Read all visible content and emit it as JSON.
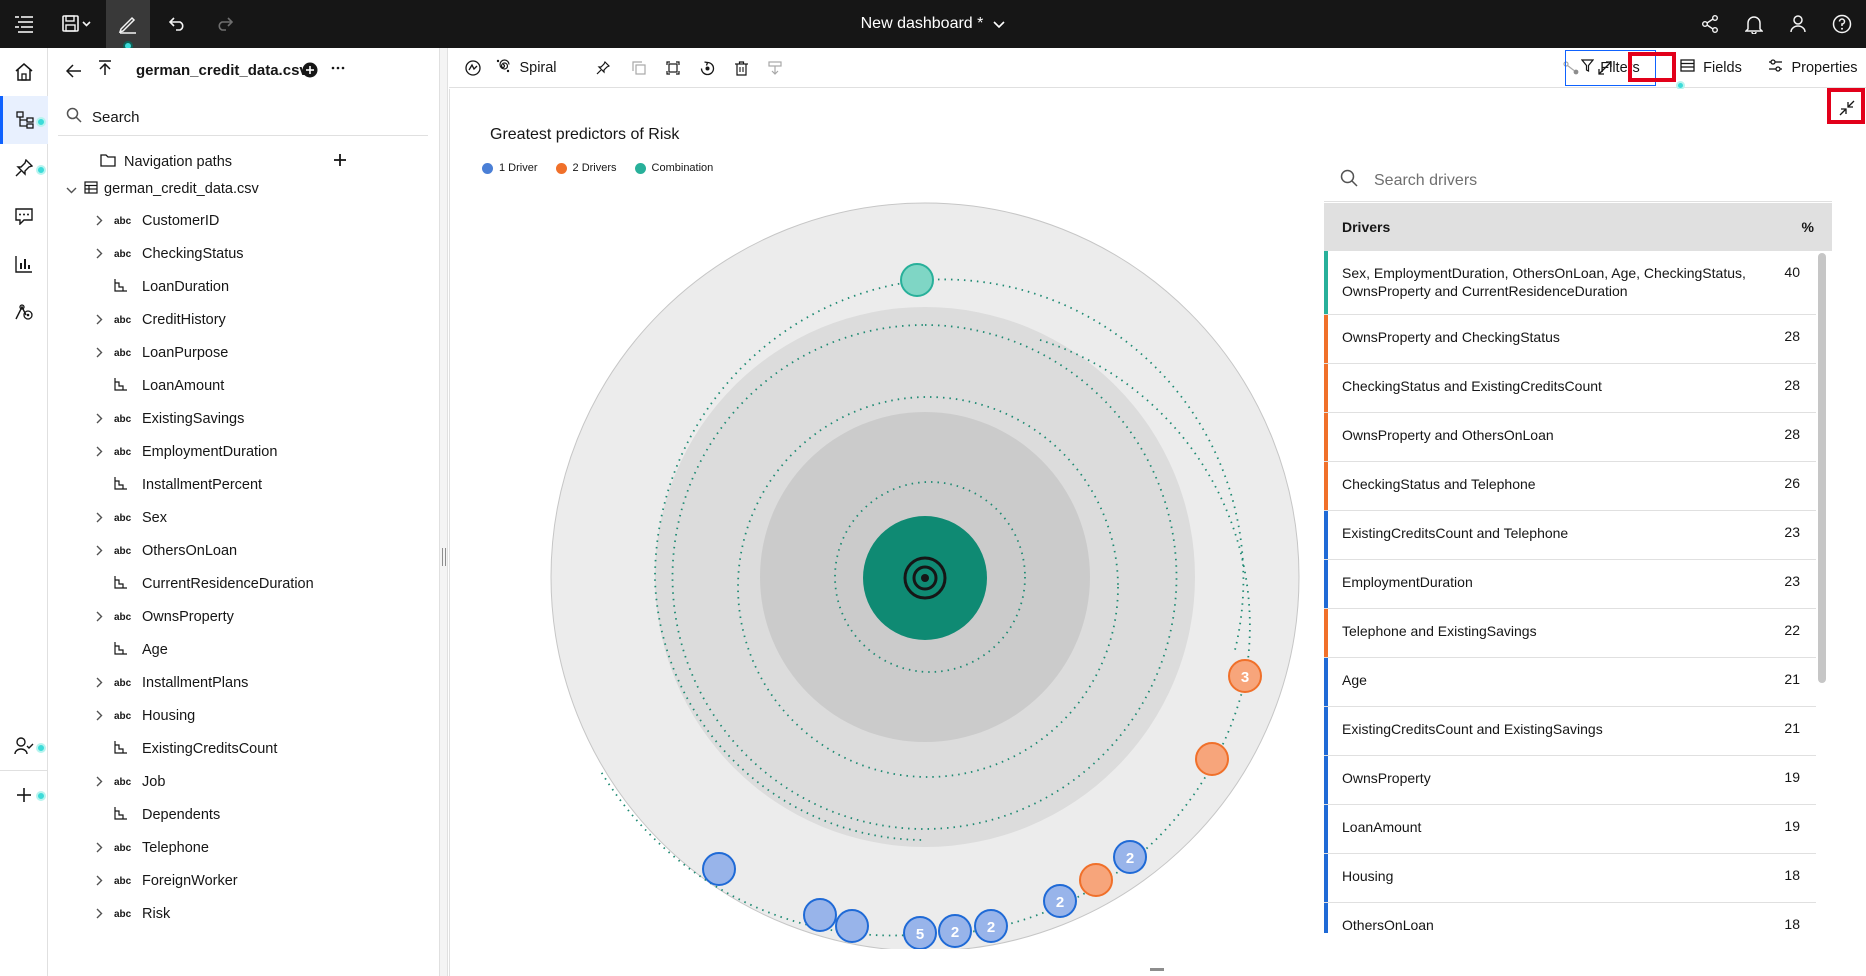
{
  "topbar": {
    "title": "New dashboard *",
    "icons": [
      "menu-icon",
      "save-icon",
      "edit-icon",
      "undo-icon",
      "redo-icon",
      "share-icon",
      "notification-icon",
      "user-icon",
      "help-icon"
    ]
  },
  "data_panel": {
    "file_name": "german_credit_data.csv",
    "search_label": "Search",
    "navigation_paths": "Navigation paths",
    "source_name": "german_credit_data.csv",
    "columns": [
      {
        "name": "CustomerID",
        "type": "abc",
        "expandable": true
      },
      {
        "name": "CheckingStatus",
        "type": "abc",
        "expandable": true
      },
      {
        "name": "LoanDuration",
        "type": "measure",
        "expandable": false
      },
      {
        "name": "CreditHistory",
        "type": "abc",
        "expandable": true
      },
      {
        "name": "LoanPurpose",
        "type": "abc",
        "expandable": true
      },
      {
        "name": "LoanAmount",
        "type": "measure",
        "expandable": false
      },
      {
        "name": "ExistingSavings",
        "type": "abc",
        "expandable": true
      },
      {
        "name": "EmploymentDuration",
        "type": "abc",
        "expandable": true
      },
      {
        "name": "InstallmentPercent",
        "type": "measure",
        "expandable": false
      },
      {
        "name": "Sex",
        "type": "abc",
        "expandable": true
      },
      {
        "name": "OthersOnLoan",
        "type": "abc",
        "expandable": true
      },
      {
        "name": "CurrentResidenceDuration",
        "type": "measure",
        "expandable": false
      },
      {
        "name": "OwnsProperty",
        "type": "abc",
        "expandable": true
      },
      {
        "name": "Age",
        "type": "measure",
        "expandable": false
      },
      {
        "name": "InstallmentPlans",
        "type": "abc",
        "expandable": true
      },
      {
        "name": "Housing",
        "type": "abc",
        "expandable": true
      },
      {
        "name": "ExistingCreditsCount",
        "type": "measure",
        "expandable": false
      },
      {
        "name": "Job",
        "type": "abc",
        "expandable": true
      },
      {
        "name": "Dependents",
        "type": "measure",
        "expandable": false
      },
      {
        "name": "Telephone",
        "type": "abc",
        "expandable": true
      },
      {
        "name": "ForeignWorker",
        "type": "abc",
        "expandable": true
      },
      {
        "name": "Risk",
        "type": "abc",
        "expandable": true
      }
    ],
    "type_badge": "abc"
  },
  "widget_toolbar": {
    "viz_type": "Spiral",
    "filters_label": "Filters",
    "fields_label": "Fields",
    "properties_label": "Properties"
  },
  "chart": {
    "title": "Greatest predictors of Risk",
    "legend": [
      {
        "label": "1 Driver",
        "color": "#4a7fd6"
      },
      {
        "label": "2 Drivers",
        "color": "#f0702a"
      },
      {
        "label": "Combination",
        "color": "#28b09a"
      }
    ],
    "bubble_labels": [
      "3",
      "2",
      "2",
      "2",
      "2",
      "5"
    ]
  },
  "drivers": {
    "search_placeholder": "Search drivers",
    "header_drivers": "Drivers",
    "header_pct": "%",
    "rows": [
      {
        "name": "Sex, EmploymentDuration, OthersOnLoan, Age, CheckingStatus, OwnsProperty and CurrentResidenceDuration",
        "pct": "40",
        "kind": "combination"
      },
      {
        "name": "OwnsProperty and CheckingStatus",
        "pct": "28",
        "kind": "two"
      },
      {
        "name": "CheckingStatus and ExistingCreditsCount",
        "pct": "28",
        "kind": "two"
      },
      {
        "name": "OwnsProperty and OthersOnLoan",
        "pct": "28",
        "kind": "two"
      },
      {
        "name": "CheckingStatus and Telephone",
        "pct": "26",
        "kind": "two"
      },
      {
        "name": "ExistingCreditsCount and Telephone",
        "pct": "23",
        "kind": "one"
      },
      {
        "name": "EmploymentDuration",
        "pct": "23",
        "kind": "one"
      },
      {
        "name": "Telephone and ExistingSavings",
        "pct": "22",
        "kind": "two"
      },
      {
        "name": "Age",
        "pct": "21",
        "kind": "one"
      },
      {
        "name": "ExistingCreditsCount and ExistingSavings",
        "pct": "21",
        "kind": "one"
      },
      {
        "name": "OwnsProperty",
        "pct": "19",
        "kind": "one"
      },
      {
        "name": "LoanAmount",
        "pct": "19",
        "kind": "one"
      },
      {
        "name": "Housing",
        "pct": "18",
        "kind": "one"
      },
      {
        "name": "OthersOnLoan",
        "pct": "18",
        "kind": "one"
      }
    ]
  },
  "colors": {
    "one": "#1f6ad6",
    "two": "#f0702a",
    "combination": "#28b09a",
    "target": "#0f8a73",
    "highlight": "#e2001a"
  }
}
